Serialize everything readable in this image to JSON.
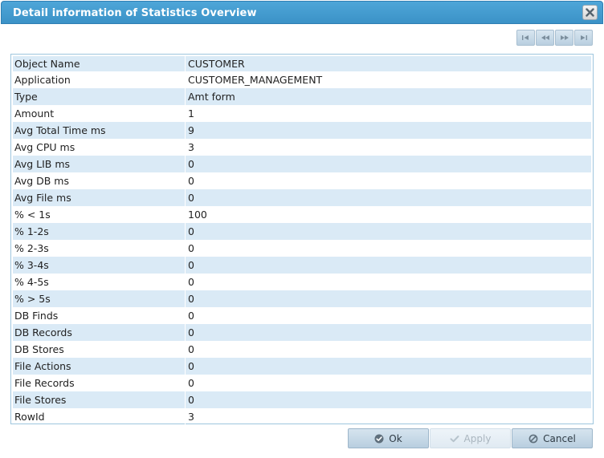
{
  "window": {
    "title": "Detail information of Statistics Overview",
    "close_icon": "close-icon"
  },
  "navigation": {
    "buttons": [
      "first-record-icon",
      "previous-record-icon",
      "next-record-icon",
      "last-record-icon"
    ]
  },
  "details": {
    "rows": [
      {
        "name": "Object Name",
        "value": "CUSTOMER"
      },
      {
        "name": "Application",
        "value": "CUSTOMER_MANAGEMENT"
      },
      {
        "name": "Type",
        "value": "Amt form"
      },
      {
        "name": "Amount",
        "value": "1"
      },
      {
        "name": "Avg Total Time ms",
        "value": "9"
      },
      {
        "name": "Avg CPU ms",
        "value": "3"
      },
      {
        "name": "Avg LIB ms",
        "value": "0"
      },
      {
        "name": "Avg DB ms",
        "value": "0"
      },
      {
        "name": "Avg File ms",
        "value": "0"
      },
      {
        "name": "% < 1s",
        "value": "100"
      },
      {
        "name": "% 1-2s",
        "value": "0"
      },
      {
        "name": "% 2-3s",
        "value": "0"
      },
      {
        "name": "% 3-4s",
        "value": "0"
      },
      {
        "name": "% 4-5s",
        "value": "0"
      },
      {
        "name": "% > 5s",
        "value": "0"
      },
      {
        "name": "DB Finds",
        "value": "0"
      },
      {
        "name": "DB Records",
        "value": "0"
      },
      {
        "name": "DB Stores",
        "value": "0"
      },
      {
        "name": "File Actions",
        "value": "0"
      },
      {
        "name": "File Records",
        "value": "0"
      },
      {
        "name": "File Stores",
        "value": "0"
      },
      {
        "name": "RowId",
        "value": "3"
      }
    ]
  },
  "footer": {
    "ok_label": "Ok",
    "apply_label": "Apply",
    "cancel_label": "Cancel"
  },
  "colors": {
    "titlebar": "#3b92c7",
    "row_alt": "#daeaf6",
    "button": "#c7d9e7"
  }
}
